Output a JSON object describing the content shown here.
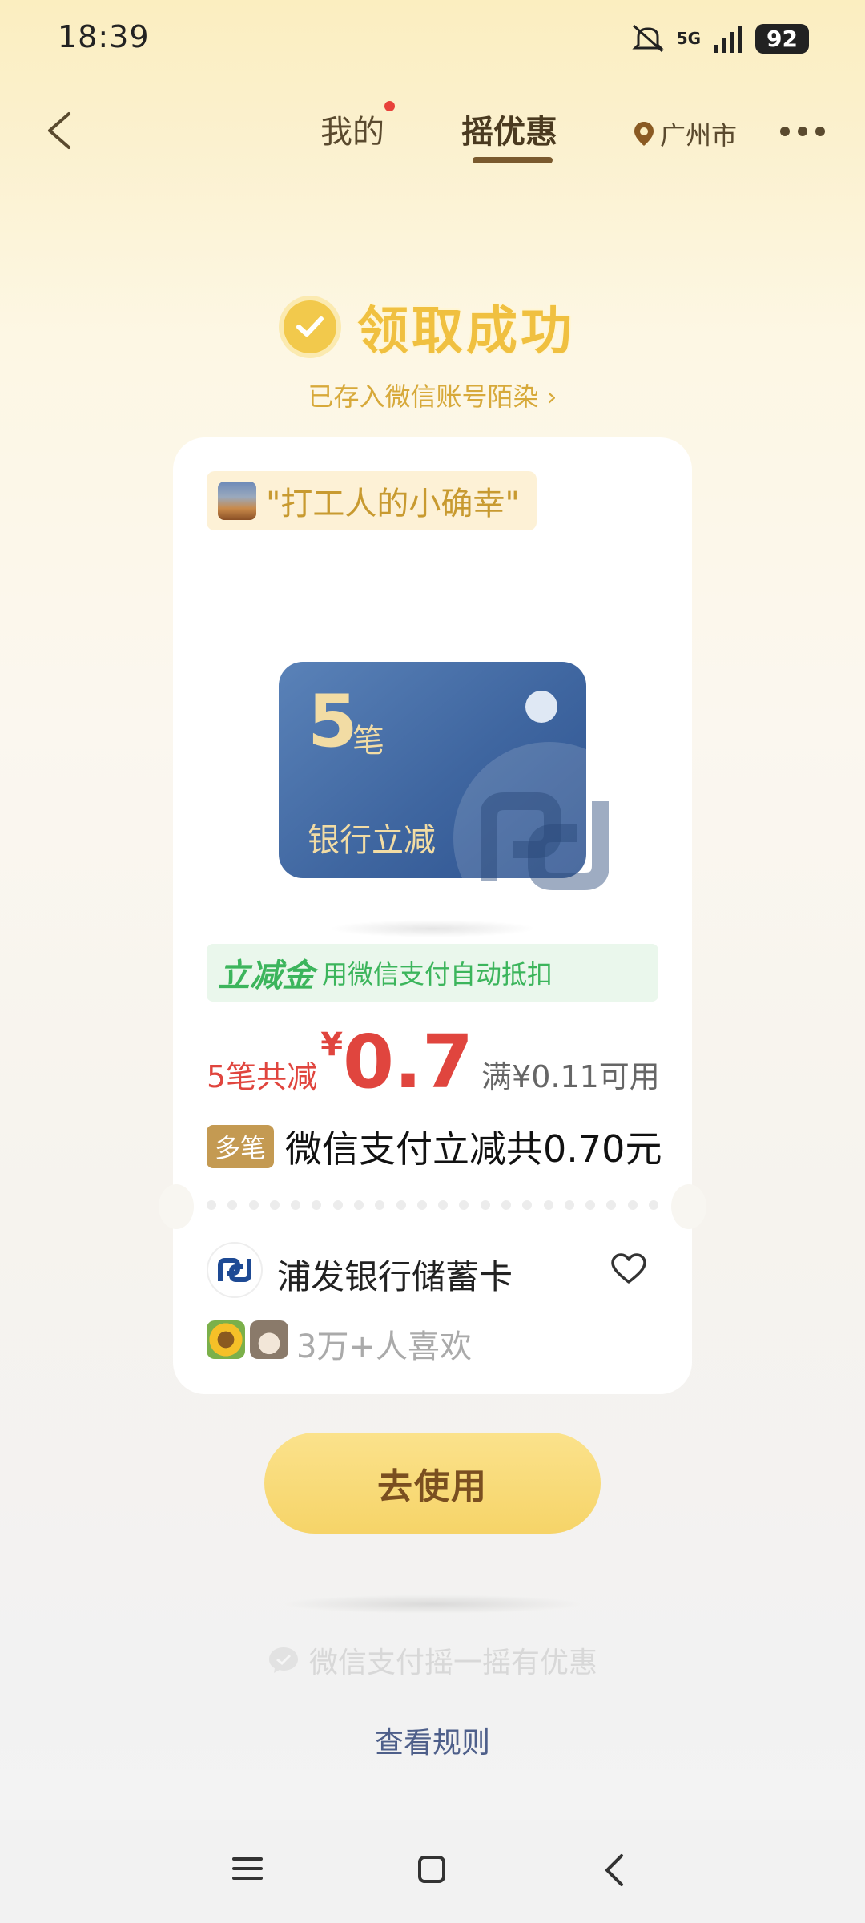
{
  "status_bar": {
    "time": "18:39",
    "network": "5G",
    "battery": "92"
  },
  "header": {
    "tabs": [
      {
        "label": "我的",
        "has_dot": true
      },
      {
        "label": "摇优惠",
        "active": true
      }
    ],
    "location": "广州市"
  },
  "success": {
    "title": "领取成功",
    "saved_to": "已存入微信账号陌染 ›"
  },
  "card": {
    "tag": "\"打工人的小确幸\"",
    "voucher": {
      "count": "5",
      "unit": "笔",
      "subtitle": "银行立减"
    },
    "benefit": {
      "name": "立减金",
      "description": "用微信支付自动抵扣"
    },
    "amount": {
      "label": "5笔共减",
      "currency": "¥",
      "value": "0.7",
      "min_spend": "满¥0.11可用"
    },
    "multi": {
      "badge": "多笔",
      "text": "微信支付立减共0.70元"
    },
    "bank": {
      "name": "浦发银行储蓄卡"
    },
    "likes": "3万+人喜欢"
  },
  "actions": {
    "use_button": "去使用"
  },
  "footer": {
    "brand": "微信支付摇一摇有优惠",
    "rules_link": "查看规则"
  },
  "colors": {
    "accent_gold": "#f0c040",
    "amount_red": "#e0453e",
    "benefit_green": "#3cb55c",
    "voucher_blue": "#3f66a0"
  }
}
